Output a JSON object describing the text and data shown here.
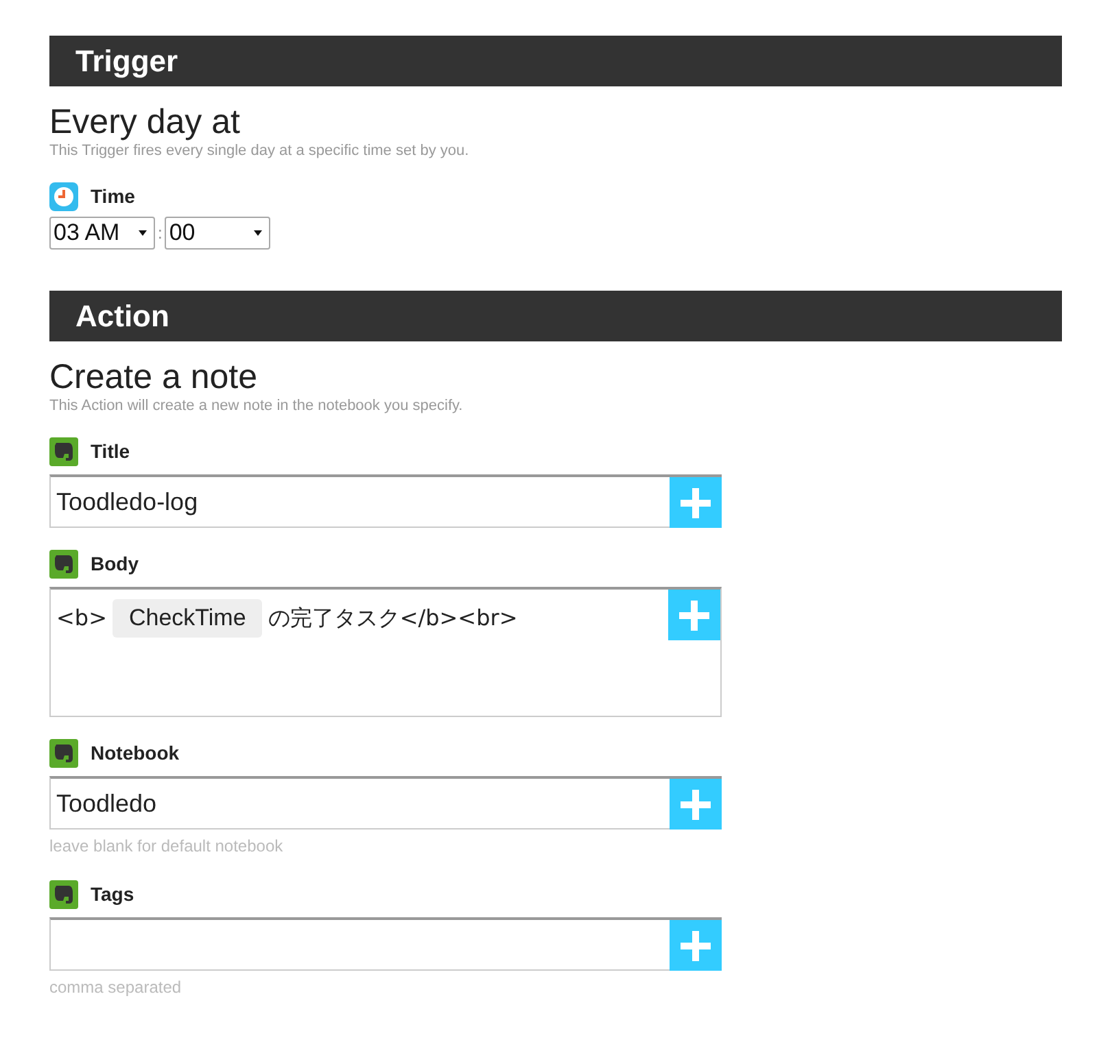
{
  "trigger": {
    "header": "Trigger",
    "title": "Every day at",
    "description": "This Trigger fires every single day at a specific time set by you.",
    "time_field": {
      "label": "Time",
      "hour": "03 AM",
      "separator": ":",
      "minute": "00"
    }
  },
  "action": {
    "header": "Action",
    "title": "Create a note",
    "description": "This Action will create a new note in the notebook you specify.",
    "fields": [
      {
        "kind": "text",
        "label": "Title",
        "value": "Toodledo-log"
      },
      {
        "kind": "textarea",
        "label": "Body",
        "segments": [
          {
            "kind": "text",
            "text": "<b>"
          },
          {
            "kind": "token",
            "text": "CheckTime"
          },
          {
            "kind": "text",
            "text": "の完了タスク</b><br>"
          }
        ]
      },
      {
        "kind": "text",
        "label": "Notebook",
        "value": "Toodledo",
        "hint": "leave blank for default notebook"
      },
      {
        "kind": "text",
        "label": "Tags",
        "hint": "comma separated"
      }
    ]
  }
}
